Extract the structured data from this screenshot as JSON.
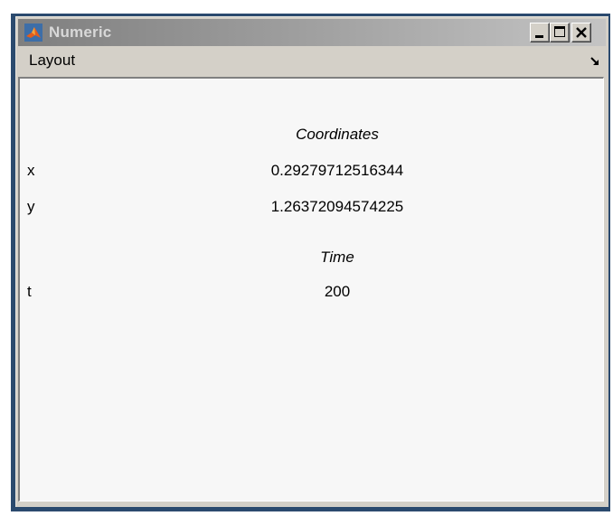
{
  "window": {
    "title": "Numeric"
  },
  "menu": {
    "layout_label": "Layout"
  },
  "sections": [
    {
      "title": "Coordinates",
      "rows": [
        {
          "label": "x",
          "value": "0.29279712516344"
        },
        {
          "label": "y",
          "value": "1.26372094574225"
        }
      ]
    },
    {
      "title": "Time",
      "rows": [
        {
          "label": "t",
          "value": "200"
        }
      ]
    }
  ],
  "icons": {
    "app": "matlab-icon",
    "minimize": "minimize-icon",
    "maximize": "maximize-icon",
    "close": "close-icon",
    "dock": "undock-arrow-icon"
  },
  "colors": {
    "title_gradient_start": "#7f7f7f",
    "title_text": "#d8d8d8",
    "content_bg": "#f7f7f7"
  }
}
